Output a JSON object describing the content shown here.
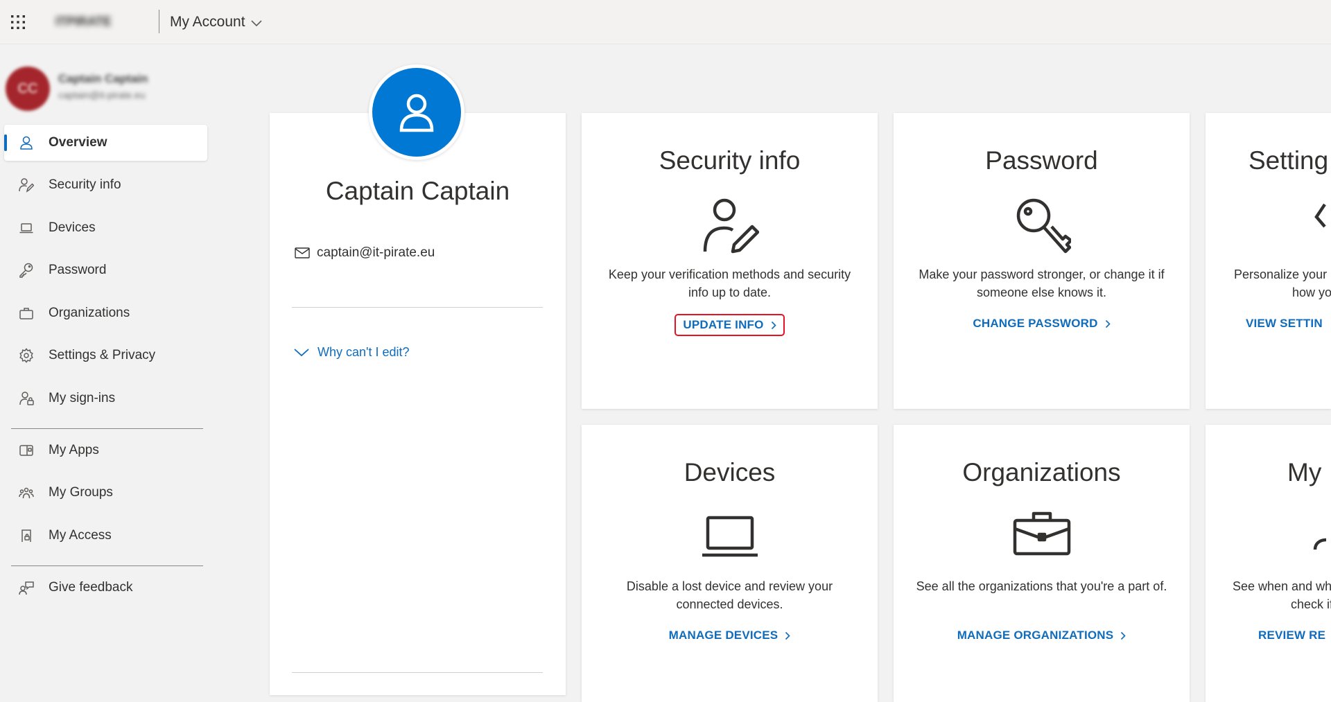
{
  "topbar": {
    "org_logo": "ITPIRATE",
    "app_title": "My Account"
  },
  "user": {
    "initials": "CC",
    "name": "Captain Captain",
    "email": "captain@it-pirate.eu"
  },
  "sidebar": {
    "items": [
      {
        "label": "Overview",
        "icon": "person-icon",
        "active": true
      },
      {
        "label": "Security info",
        "icon": "person-pen-icon"
      },
      {
        "label": "Devices",
        "icon": "laptop-icon"
      },
      {
        "label": "Password",
        "icon": "key-icon"
      },
      {
        "label": "Organizations",
        "icon": "briefcase-icon"
      },
      {
        "label": "Settings & Privacy",
        "icon": "gear-icon"
      },
      {
        "label": "My sign-ins",
        "icon": "person-lock-icon"
      },
      {
        "label": "My Apps",
        "icon": "apps-icon"
      },
      {
        "label": "My Groups",
        "icon": "groups-icon"
      },
      {
        "label": "My Access",
        "icon": "access-icon"
      },
      {
        "label": "Give feedback",
        "icon": "feedback-icon"
      }
    ]
  },
  "profile": {
    "name": "Captain Captain",
    "email": "captain@it-pirate.eu",
    "why_edit": "Why can't I edit?"
  },
  "tiles": {
    "security": {
      "title": "Security info",
      "desc": "Keep your verification methods and security info up to date.",
      "link": "UPDATE INFO"
    },
    "password": {
      "title": "Password",
      "desc": "Make your password stronger, or change it if someone else knows it.",
      "link": "CHANGE PASSWORD"
    },
    "settings": {
      "title": "Setting",
      "desc": "Personalize your",
      "desc2": "how yo",
      "link": "VIEW SETTIN"
    },
    "devices": {
      "title": "Devices",
      "desc": "Disable a lost device and review your connected devices.",
      "link": "MANAGE DEVICES"
    },
    "organizations": {
      "title": "Organizations",
      "desc": "See all the organizations that you're a part of.",
      "link": "MANAGE ORGANIZATIONS"
    },
    "signins": {
      "title": "My",
      "desc": "See when and wh",
      "desc2": "check if any",
      "link": "REVIEW RE"
    }
  },
  "colors": {
    "accent": "#0f6cbd",
    "avatar_blue": "#0078d4",
    "user_avatar": "#a4262c",
    "highlight_border": "#e81123"
  }
}
